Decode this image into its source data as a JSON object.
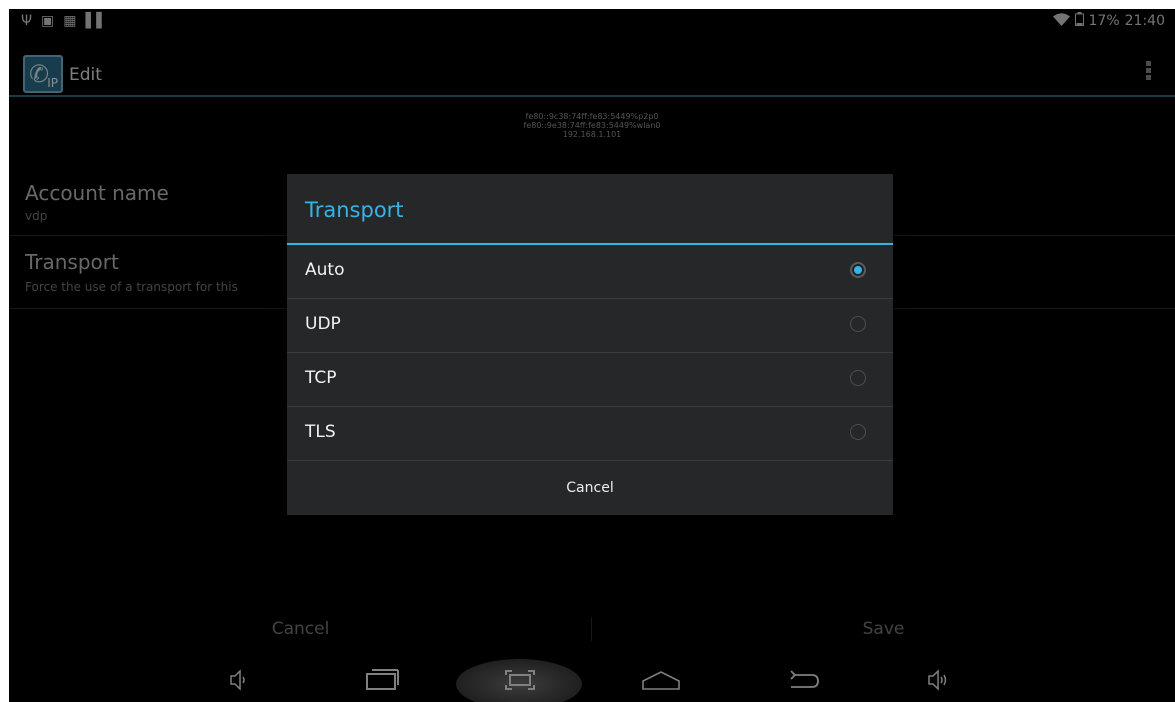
{
  "status_bar": {
    "left_icons": [
      "usb-icon",
      "image-icon",
      "app-icon",
      "barcode-icon"
    ],
    "battery": "17%",
    "time": "21:40"
  },
  "action_bar": {
    "app_icon_text": "IP",
    "title": "Edit"
  },
  "ip_addresses": [
    "fe80::9c38:74ff:fe83:5449%p2p0",
    "fe80::9e38:74ff:fe83:5449%wlan0",
    "192.168.1.101"
  ],
  "preferences": [
    {
      "title": "Account name",
      "summary": "vdp"
    },
    {
      "title": "Transport",
      "summary": "Force the use of a transport for this"
    }
  ],
  "bottom_buttons": {
    "cancel": "Cancel",
    "save": "Save"
  },
  "dialog": {
    "title": "Transport",
    "options": [
      "Auto",
      "UDP",
      "TCP",
      "TLS"
    ],
    "selected": "Auto",
    "cancel": "Cancel"
  },
  "colors": {
    "accent": "#33b5e5",
    "dialog_bg": "#262729",
    "screen_bg": "#000000"
  }
}
